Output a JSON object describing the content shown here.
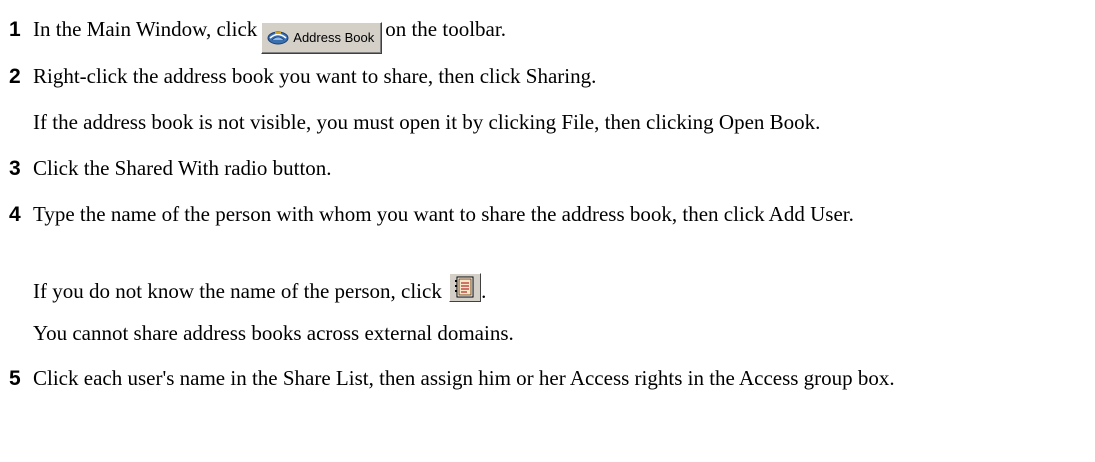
{
  "steps": [
    {
      "number": "1",
      "text_before": "In the Main Window, click",
      "button_label": "Address Book",
      "button_icon": "address-book-icon",
      "text_after": "on the toolbar."
    },
    {
      "number": "2",
      "text": "Right-click the address book you want to share, then click Sharing.",
      "note": "If the address book is not visible, you must open it by clicking File, then clicking Open Book."
    },
    {
      "number": "3",
      "text": "Click the Shared With radio button."
    },
    {
      "number": "4",
      "text": "Type the name of the person with whom you want to share the address book, then click Add User.",
      "note1_before": "If you do not know the name of the person, click",
      "note1_icon": "address-selector-icon",
      "note1_after": ".",
      "note2": "You cannot share address books across external domains."
    },
    {
      "number": "5",
      "text": "Click each user's name in the Share List, then assign him or her Access rights in the Access group box."
    }
  ]
}
